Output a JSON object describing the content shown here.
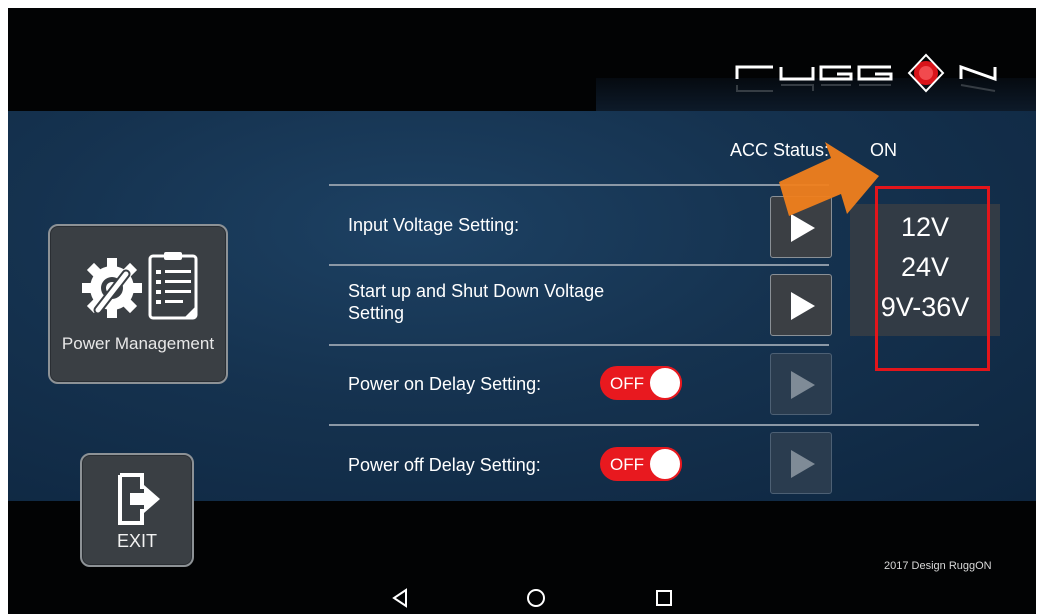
{
  "brand": {
    "logo_text": "RUGGON"
  },
  "left_panel": {
    "power_button_label": "Power Management",
    "exit_button_label": "EXIT"
  },
  "acc": {
    "label": "ACC Status:",
    "value": "ON"
  },
  "rows": [
    {
      "label": "Input Voltage Setting:",
      "has_toggle": false,
      "enabled": true
    },
    {
      "label": "Start up and Shut Down Voltage Setting",
      "has_toggle": false,
      "enabled": true
    },
    {
      "label": "Power on Delay Setting:",
      "toggle": "OFF",
      "enabled": false
    },
    {
      "label": "Power off Delay Setting:",
      "toggle": "OFF",
      "enabled": false
    }
  ],
  "voltage_options": [
    "12V",
    "24V",
    "9V-36V"
  ],
  "footer": {
    "copyright": "2017 Design RuggON"
  },
  "colors": {
    "accent_red": "#e8191f",
    "highlight_red": "#e3151b",
    "arrow_orange": "#f07f1c",
    "main_bg": "#15324f"
  },
  "icons": {
    "power_management": "gear-wrench-clipboard-icon",
    "exit": "exit-door-icon",
    "play": "play-triangle-icon",
    "nav_back": "back-triangle-icon",
    "nav_home": "home-circle-icon",
    "nav_recents": "recents-square-icon"
  }
}
